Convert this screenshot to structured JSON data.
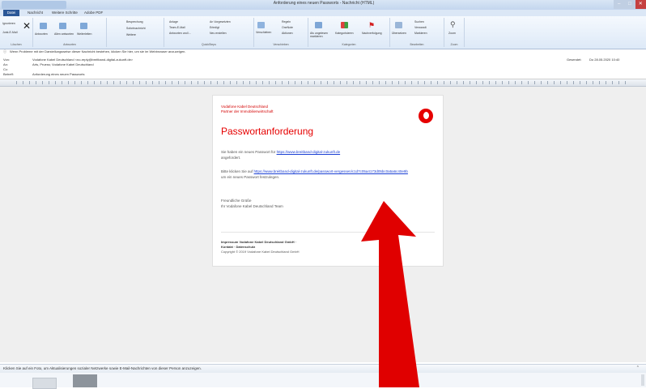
{
  "window": {
    "title": "Anforderung eines neuen Passworts - Nachricht (HTML)",
    "min": "–",
    "max": "□",
    "close": "✕"
  },
  "ribbon_tabs": [
    "Datei",
    "Nachricht",
    "Weitere Schritte",
    "Adobe PDF"
  ],
  "ribbon": {
    "groups": [
      {
        "label": "Löschen",
        "items": [
          "Ignorieren",
          "Junk-E-Mail",
          "Löschen"
        ]
      },
      {
        "label": "Antworten",
        "items": [
          "Antworten",
          "Allen antworten",
          "Weiterleiten"
        ]
      },
      {
        "label": "",
        "items": [
          "Besprechung",
          "Sofortnachricht",
          "Weitere"
        ]
      },
      {
        "label": "QuickSteps",
        "items": [
          "Anlage",
          "Team-E-Mail",
          "Antworten und l...",
          "An Vorgesetzten",
          "Erledigt",
          "Neu erstellen"
        ]
      },
      {
        "label": "Verschieben",
        "items": [
          "Verschieben",
          "Regeln",
          "OneNote",
          "Aktionen"
        ]
      },
      {
        "label": "Kategorien",
        "items": [
          "Als ungelesen markieren",
          "Kategorisieren",
          "Nachverfolgung"
        ]
      },
      {
        "label": "Bearbeiten",
        "items": [
          "Übersetzen",
          "Suchen",
          "Verwandt",
          "Markieren"
        ]
      },
      {
        "label": "Zoom",
        "items": [
          "Zoom"
        ]
      }
    ]
  },
  "infobar": "Wenn Probleme mit der Darstellungsweise dieser Nachricht bestehen, klicken Sie hier, um sie im Webbrowser anzuzeigen.",
  "header": {
    "from_label": "Von:",
    "from": "Vodafone Kabel Deutschland <no-reply@breitband-digital-zukunft.de>",
    "to_label": "An:",
    "to": "Arts, Pruess; Vodafone Kabel Deutschland",
    "cc_label": "Cc:",
    "subject_label": "Betreff:",
    "subject": "Anforderung eines neuen Passworts",
    "sent_label": "Gesendet:",
    "sent": "Do 28.05.2020 10:40"
  },
  "email": {
    "brand_line1": "Vodafone Kabel Deutschland",
    "brand_line2": "Partner der Immobilienwirtschaft",
    "title": "Passwortanforderung",
    "p1_text": "Sie haben ein neues Passwort für",
    "p1_link": "https://www.breitband-digital-zukunft.de",
    "p1_end": "angefordert.",
    "p2_text": "Bitte klicken Sie auf",
    "p2_link": "https://www.breitband-digital-zukunft.de/passwort-vergessen/c1d7c05a4173d05bc0a5a6c40e9b",
    "p2_end": "um ein neues Passwort festzulegen.",
    "greeting": "Freundliche Grüße",
    "signature": "Ihr Vodafone Kabel Deutschland Team",
    "foot1": "Impressum Vodafone Kabel Deutschland GmbH ·",
    "foot2": "Kontakt · Datenschutz",
    "foot3": "Copyright © 2019 Vodafone Kabel Deutschland GmbH"
  },
  "people_pane": {
    "text": "Klicken Sie auf ein Foto, um Aktualisierungen sozialer Netzwerke sowie E-Mail-Nachrichten von dieser Person anzuzeigen."
  },
  "colors": {
    "vodafone_red": "#e60000",
    "link_blue": "#1a3fd4",
    "annotation_arrow": "#e00000"
  },
  "icons": [
    "vodafone-logo-icon",
    "annotation-arrow-icon"
  ]
}
